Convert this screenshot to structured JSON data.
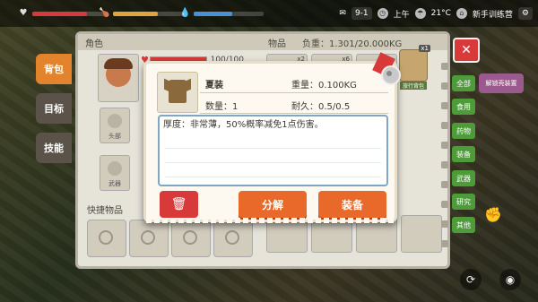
{
  "hud": {
    "health_pct": 0.72,
    "hunger_pct": 0.62,
    "thirst_pct": 0.55,
    "level": "9-1",
    "time": "上午",
    "temperature": "21°C",
    "camp": "新手训练营",
    "colors": {
      "health": "#d63a3a",
      "hunger": "#e0a43a",
      "thirst": "#4a90d6"
    }
  },
  "nav": {
    "tabs": [
      {
        "label": "背包",
        "active": true
      },
      {
        "label": "目标",
        "active": false
      },
      {
        "label": "技能",
        "active": false
      }
    ]
  },
  "character": {
    "title": "角色",
    "hp_value": "100/100",
    "hp_pct": 1.0,
    "slots": [
      {
        "label": "头部"
      },
      {
        "label": "武器"
      }
    ],
    "quick_title": "快捷物品"
  },
  "inventory": {
    "title": "物品",
    "weight_label": "负重：1.301/20.000KG",
    "visible_cells": [
      {
        "qty": "x2"
      },
      {
        "qty": "x6"
      }
    ],
    "pack": {
      "label": "旅行背包",
      "qty": "x1"
    }
  },
  "categories": [
    "全部",
    "食用",
    "药物",
    "装备",
    "武器",
    "研究",
    "其他"
  ],
  "unlock_label": "解锁壳装置",
  "popup": {
    "item_name": "夏装",
    "weight_label": "重量：0.100KG",
    "qty_label": "数量：1",
    "durability_label": "耐久：0.5/0.5",
    "description": "厚度：非常薄，50%概率减免1点伤害。",
    "decompose_label": "分解",
    "equip_label": "装备"
  }
}
